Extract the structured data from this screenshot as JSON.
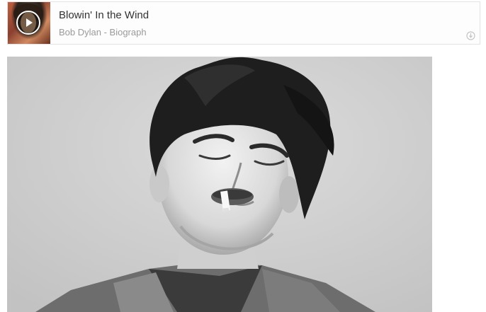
{
  "player": {
    "title": "Blowin' In the Wind",
    "subtitle": "Bob Dylan - Biograph",
    "cover_alt_icon": "album-cover",
    "play_icon": "play-icon",
    "brand_icon": "music-service-logo-icon"
  },
  "photo": {
    "icon": "portrait-photo"
  }
}
